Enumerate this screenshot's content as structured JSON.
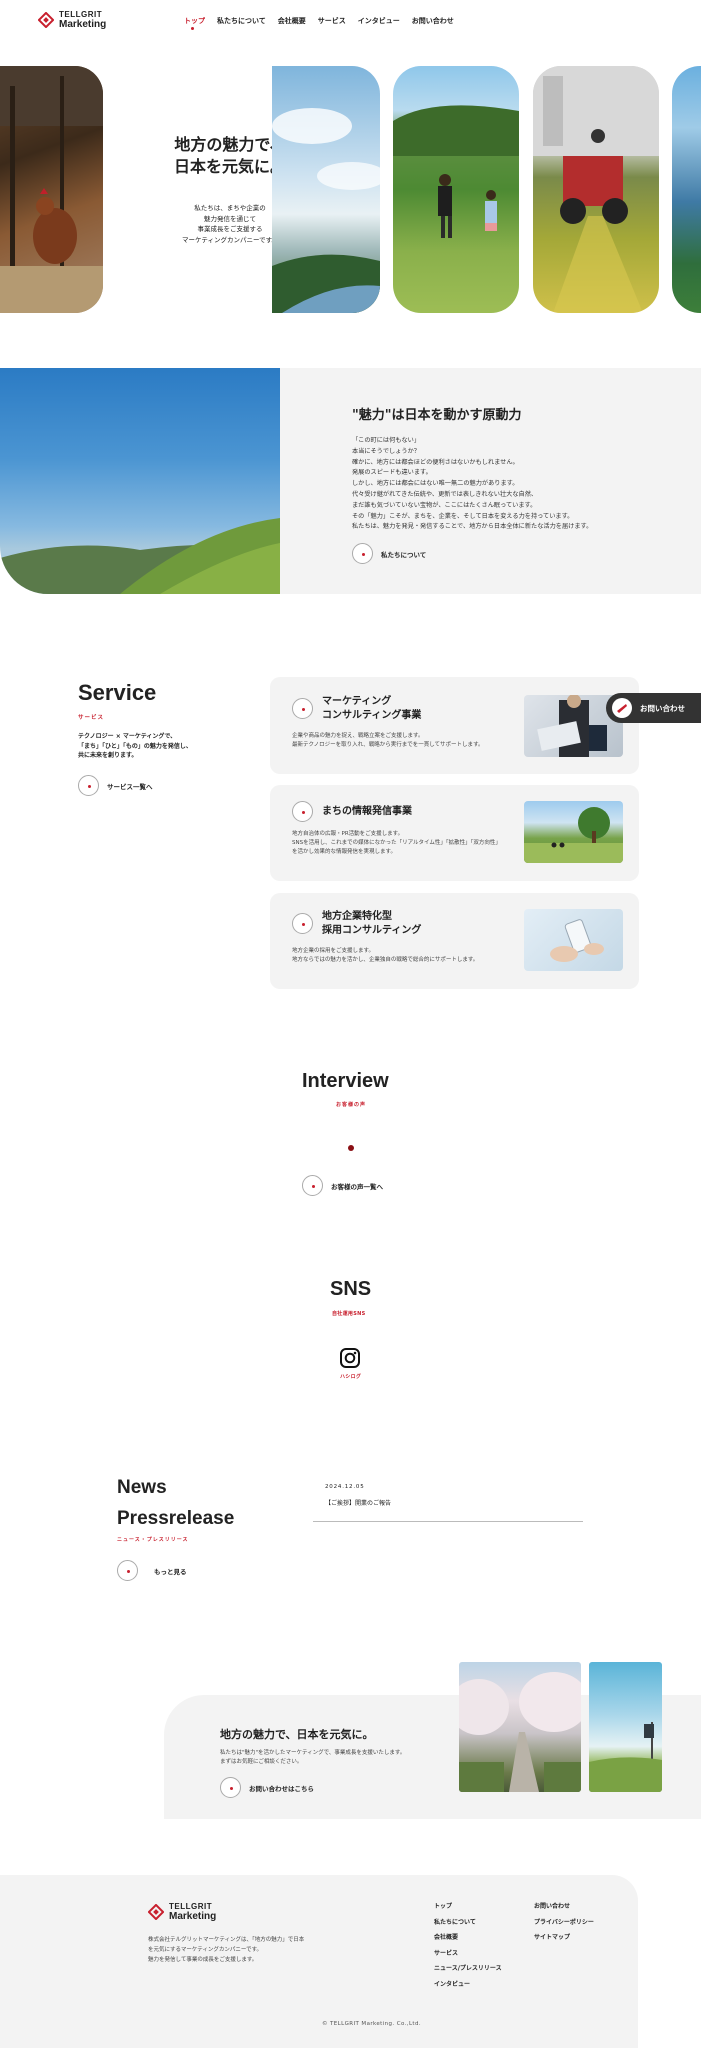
{
  "header": {
    "logo_top": "TELLGRIT",
    "logo_bottom": "Marketing",
    "nav": [
      "トップ",
      "私たちについて",
      "会社概要",
      "サービス",
      "インタビュー",
      "お問い合わせ"
    ]
  },
  "hero": {
    "title_line1": "地方の魅力で、",
    "title_line2": "日本を元気に。",
    "sub_lines": [
      "私たちは、まちや企業の",
      "魅力発信を通じて",
      "事業成長をご支援する",
      "マーケティングカンパニーです。"
    ]
  },
  "about": {
    "title": "\"魅力\"は日本を動かす原動力",
    "body_lines": [
      "「この町には何もない」",
      "本当にそうでしょうか？",
      "確かに、地方には都会ほどの便利さはないかもしれません。",
      "発展のスピードも違います。",
      "しかし、地方には都会にはない唯一無二の魅力があります。",
      "代々受け継がれてきた伝統や、更新では表しきれない壮大な自然、",
      "まだ誰も気づいていない宝物が、ここにはたくさん眠っています。",
      "その「魅力」こそが、まちを、企業を、そして日本を変える力を持っています。",
      "私たちは、魅力を発見・発信することで、地方から日本全体に新たな活力を届けます。"
    ],
    "button": "私たちについて"
  },
  "service": {
    "title": "Service",
    "subtitle": "サービス",
    "desc_lines": [
      "テクノロジー × マーケティングで、",
      "「まち」「ひと」「もの」の魅力を発信し、",
      "共に未来を創ります。"
    ],
    "button": "サービス一覧へ",
    "cards": [
      {
        "title1": "マーケティング",
        "title2": "コンサルティング事業",
        "text1": "企業や商品の魅力を捉え、戦略立案をご支援します。",
        "text2": "最新テクノロジーを取り入れ、戦略から実行までを一貫してサポートします。"
      },
      {
        "title1": "まちの情報発信事業",
        "title2": "",
        "text1": "地方自治体の広報・PR活動をご支援します。",
        "text2": "SNSを活用し、これまでの媒体になかった「リアルタイム性」「拡散性」「双方向性」を活かし効果的な情報発信を実現します。"
      },
      {
        "title1": "地方企業特化型",
        "title2": "採用コンサルティング",
        "text1": "地方企業の採用をご支援します。",
        "text2": "地方ならではの魅力を活かし、企業独自の戦略で総合的にサポートします。"
      }
    ],
    "contact_tab": "お問い合わせ"
  },
  "interview": {
    "title": "Interview",
    "subtitle": "お客様の声",
    "button": "お客様の声一覧へ"
  },
  "sns": {
    "title": "SNS",
    "subtitle": "自社運用SNS",
    "instagram_label": "ハシログ"
  },
  "news": {
    "title1": "News",
    "title2": "Pressrelease",
    "subtitle": "ニュース・プレスリリース",
    "button": "もっと見る",
    "date": "2024.12.05",
    "item": "【ご挨拶】開業のご報告"
  },
  "cta": {
    "title": "地方の魅力で、日本を元気に。",
    "text1": "私たちは\"魅力\"を活かしたマーケティングで、事業成長を支援いたします。",
    "text2": "まずはお気軽にご相談ください。",
    "button": "お問い合わせはこちら"
  },
  "footer": {
    "desc_lines": [
      "株式会社テルグリットマーケティングは、「地方の魅力」で日本",
      "を元気にするマーケティングカンパニーです。",
      "魅力を発信して事業の成長をご支援します。"
    ],
    "col1": [
      "トップ",
      "私たちについて",
      "会社概要",
      "サービス",
      "ニュース/プレスリリース",
      "インタビュー"
    ],
    "col2": [
      "お問い合わせ",
      "プライバシーポリシー",
      "サイトマップ"
    ],
    "copyright": "© TELLGRIT Marketing. Co.,Ltd."
  },
  "colors": {
    "accent": "#c8202e",
    "bg_gray": "#f3f3f3"
  }
}
